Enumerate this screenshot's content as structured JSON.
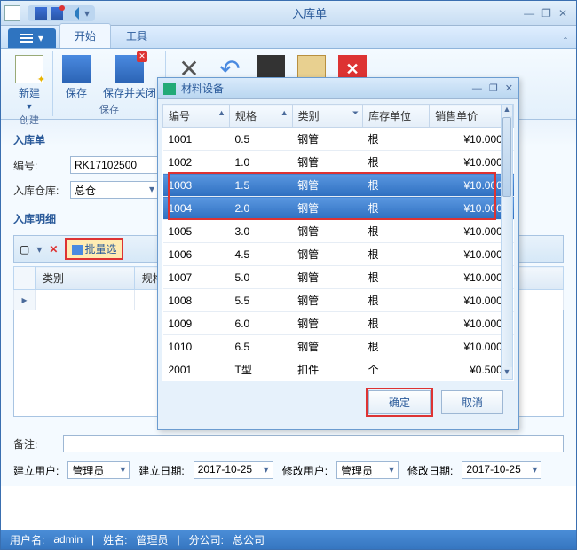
{
  "window": {
    "title": "入库单",
    "minimize": "—",
    "restore": "❐",
    "close": "✕"
  },
  "ribbon": {
    "menu": "",
    "tabs": {
      "start": "开始",
      "tools": "工具"
    },
    "groups": {
      "create": {
        "label": "创建",
        "new": "新建"
      },
      "save": {
        "label": "保存",
        "save": "保存",
        "save_close": "保存并关闭"
      }
    }
  },
  "form": {
    "section": "入库单",
    "id_label": "编号:",
    "id_value": "RK17102500",
    "wh_label": "入库仓库:",
    "wh_value": "总仓"
  },
  "detail": {
    "section": "入库明细",
    "batch": "批量选",
    "cols": {
      "cat": "类别",
      "spec": "规格"
    }
  },
  "remark_label": "备注:",
  "footer": {
    "cu_label": "建立用户:",
    "cu_value": "管理员",
    "cd_label": "建立日期:",
    "cd_value": "2017-10-25",
    "mu_label": "修改用户:",
    "mu_value": "管理员",
    "md_label": "修改日期:",
    "md_value": "2017-10-25"
  },
  "status": {
    "user_label": "用户名:",
    "user": "admin",
    "name_label": "姓名:",
    "name": "管理员",
    "branch_label": "分公司:",
    "branch": "总公司"
  },
  "dialog": {
    "title": "材料设备",
    "cols": {
      "code": "编号",
      "spec": "规格",
      "cat": "类别",
      "unit": "库存单位",
      "price": "销售单价"
    },
    "rows": [
      {
        "code": "1001",
        "spec": "0.5",
        "cat": "钢管",
        "unit": "根",
        "price": "¥10.0000",
        "sel": false
      },
      {
        "code": "1002",
        "spec": "1.0",
        "cat": "钢管",
        "unit": "根",
        "price": "¥10.0000",
        "sel": false
      },
      {
        "code": "1003",
        "spec": "1.5",
        "cat": "钢管",
        "unit": "根",
        "price": "¥10.0000",
        "sel": true
      },
      {
        "code": "1004",
        "spec": "2.0",
        "cat": "钢管",
        "unit": "根",
        "price": "¥10.0000",
        "sel": true
      },
      {
        "code": "1005",
        "spec": "3.0",
        "cat": "钢管",
        "unit": "根",
        "price": "¥10.0000",
        "sel": false
      },
      {
        "code": "1006",
        "spec": "4.5",
        "cat": "钢管",
        "unit": "根",
        "price": "¥10.0000",
        "sel": false
      },
      {
        "code": "1007",
        "spec": "5.0",
        "cat": "钢管",
        "unit": "根",
        "price": "¥10.0000",
        "sel": false
      },
      {
        "code": "1008",
        "spec": "5.5",
        "cat": "钢管",
        "unit": "根",
        "price": "¥10.0000",
        "sel": false
      },
      {
        "code": "1009",
        "spec": "6.0",
        "cat": "钢管",
        "unit": "根",
        "price": "¥10.0000",
        "sel": false
      },
      {
        "code": "1010",
        "spec": "6.5",
        "cat": "钢管",
        "unit": "根",
        "price": "¥10.0000",
        "sel": false
      },
      {
        "code": "2001",
        "spec": "T型",
        "cat": "扣件",
        "unit": "个",
        "price": "¥0.5000",
        "sel": false
      }
    ],
    "ok": "确定",
    "cancel": "取消"
  }
}
